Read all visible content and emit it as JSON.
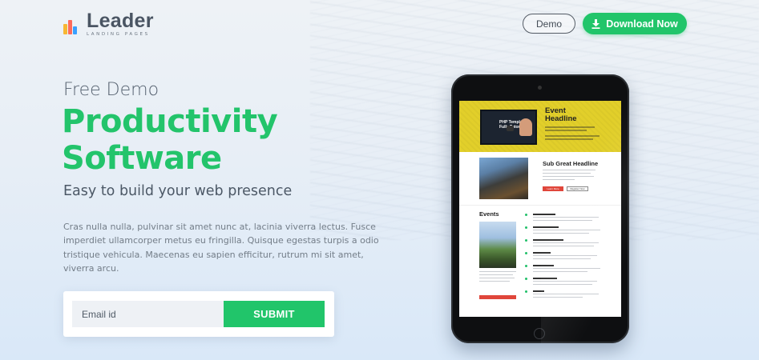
{
  "header": {
    "logo_word": "Leader",
    "logo_sub": "LANDING PAGES",
    "demo_label": "Demo",
    "download_label": "Download Now"
  },
  "hero": {
    "pre_title": "Free Demo",
    "title_line1": "Productivity",
    "title_line2": "Software",
    "subtitle": "Easy to build your web presence",
    "body": "Cras nulla nulla, pulvinar sit amet nunc at, lacinia viverra lectus. Fusce imperdiet ullamcorper metus eu fringilla. Quisque egestas turpis a odio tristique vehicula. Maecenas eu sapien efficitur, rutrum mi sit amet, viverra arcu."
  },
  "form": {
    "email_placeholder": "Email id",
    "submit_label": "SUBMIT"
  },
  "tablet_screen": {
    "hero_title_line1": "Event",
    "hero_title_line2": "Headline",
    "video_title_line1": "PHP Template",
    "video_title_line2": "Fully Tutorial",
    "sub_headline": "Sub Great Headline",
    "btn_primary": "Learn More",
    "btn_secondary": "Register Now",
    "events_title": "Events"
  },
  "colors": {
    "accent_green": "#21c56a",
    "heading_green": "#23c46b",
    "tablet_banner_yellow": "#e2cf2a",
    "tablet_red": "#e0463b"
  },
  "icons": [
    "logo-bars-icon",
    "download-icon"
  ]
}
